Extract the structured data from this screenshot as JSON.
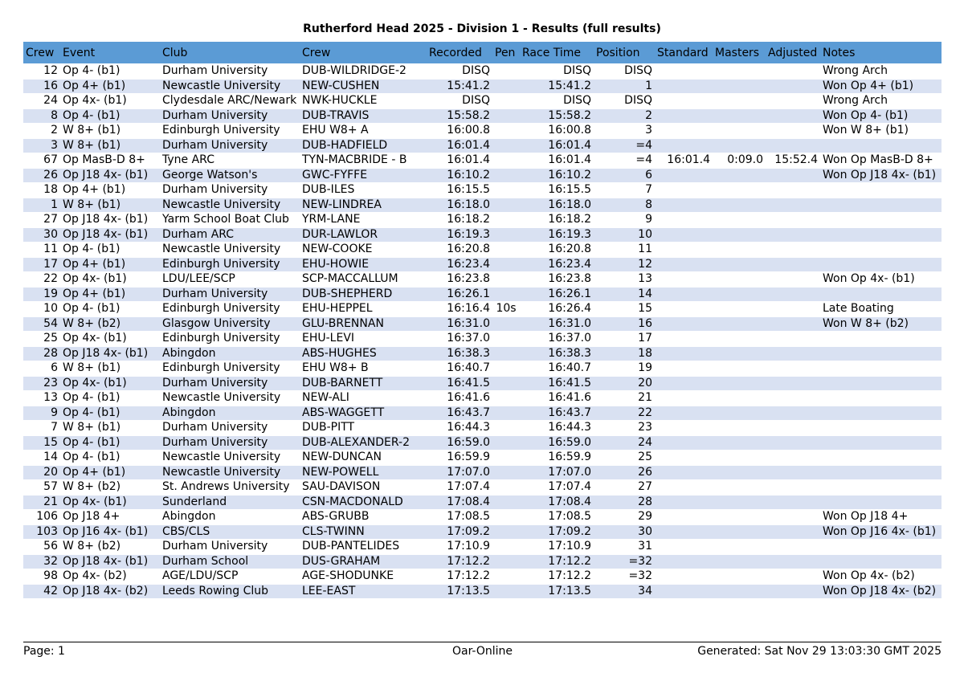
{
  "title": "Rutherford Head 2025 - Division 1 - Results (full results)",
  "colors": {
    "header_bg": "#5b9bd5",
    "stripe_bg": "#d9e1f2"
  },
  "columns": [
    "Crew",
    "Event",
    "Club",
    "Crew",
    "Recorded",
    "Pen",
    "Race Time",
    "Position",
    "Standard",
    "Masters",
    "Adjusted",
    "Notes"
  ],
  "rows": [
    [
      "12",
      "Op 4- (b1)",
      "Durham University",
      "DUB-WILDRIDGE-2",
      "DISQ",
      "",
      "DISQ",
      "DISQ",
      "",
      "",
      "",
      "Wrong Arch"
    ],
    [
      "16",
      "Op 4+ (b1)",
      "Newcastle University",
      "NEW-CUSHEN",
      "15:41.2",
      "",
      "15:41.2",
      "1",
      "",
      "",
      "",
      "Won Op 4+ (b1)"
    ],
    [
      "24",
      "Op 4x- (b1)",
      "Clydesdale ARC/Newark",
      "NWK-HUCKLE",
      "DISQ",
      "",
      "DISQ",
      "DISQ",
      "",
      "",
      "",
      "Wrong Arch"
    ],
    [
      "8",
      "Op 4- (b1)",
      "Durham University",
      "DUB-TRAVIS",
      "15:58.2",
      "",
      "15:58.2",
      "2",
      "",
      "",
      "",
      "Won Op 4- (b1)"
    ],
    [
      "2",
      "W 8+ (b1)",
      "Edinburgh University",
      "EHU W8+ A",
      "16:00.8",
      "",
      "16:00.8",
      "3",
      "",
      "",
      "",
      "Won W 8+ (b1)"
    ],
    [
      "3",
      "W 8+ (b1)",
      "Durham University",
      "DUB-HADFIELD",
      "16:01.4",
      "",
      "16:01.4",
      "=4",
      "",
      "",
      "",
      ""
    ],
    [
      "67",
      "Op MasB-D 8+",
      "Tyne ARC",
      "TYN-MACBRIDE - B",
      "16:01.4",
      "",
      "16:01.4",
      "=4",
      "16:01.4",
      "0:09.0",
      "15:52.4",
      "Won Op MasB-D 8+"
    ],
    [
      "26",
      "Op J18 4x- (b1)",
      "George Watson's",
      "GWC-FYFFE",
      "16:10.2",
      "",
      "16:10.2",
      "6",
      "",
      "",
      "",
      "Won Op J18 4x- (b1)"
    ],
    [
      "18",
      "Op 4+ (b1)",
      "Durham University",
      "DUB-ILES",
      "16:15.5",
      "",
      "16:15.5",
      "7",
      "",
      "",
      "",
      ""
    ],
    [
      "1",
      "W 8+ (b1)",
      "Newcastle University",
      "NEW-LINDREA",
      "16:18.0",
      "",
      "16:18.0",
      "8",
      "",
      "",
      "",
      ""
    ],
    [
      "27",
      "Op J18 4x- (b1)",
      "Yarm School Boat Club",
      "YRM-LANE",
      "16:18.2",
      "",
      "16:18.2",
      "9",
      "",
      "",
      "",
      ""
    ],
    [
      "30",
      "Op J18 4x- (b1)",
      "Durham ARC",
      "DUR-LAWLOR",
      "16:19.3",
      "",
      "16:19.3",
      "10",
      "",
      "",
      "",
      ""
    ],
    [
      "11",
      "Op 4- (b1)",
      "Newcastle University",
      "NEW-COOKE",
      "16:20.8",
      "",
      "16:20.8",
      "11",
      "",
      "",
      "",
      ""
    ],
    [
      "17",
      "Op 4+ (b1)",
      "Edinburgh University",
      "EHU-HOWIE",
      "16:23.4",
      "",
      "16:23.4",
      "12",
      "",
      "",
      "",
      ""
    ],
    [
      "22",
      "Op 4x- (b1)",
      "LDU/LEE/SCP",
      "SCP-MACCALLUM",
      "16:23.8",
      "",
      "16:23.8",
      "13",
      "",
      "",
      "",
      "Won Op 4x- (b1)"
    ],
    [
      "19",
      "Op 4+ (b1)",
      "Durham University",
      "DUB-SHEPHERD",
      "16:26.1",
      "",
      "16:26.1",
      "14",
      "",
      "",
      "",
      ""
    ],
    [
      "10",
      "Op 4- (b1)",
      "Edinburgh University",
      "EHU-HEPPEL",
      "16:16.4",
      "10s",
      "16:26.4",
      "15",
      "",
      "",
      "",
      "Late Boating"
    ],
    [
      "54",
      "W 8+ (b2)",
      "Glasgow University",
      "GLU-BRENNAN",
      "16:31.0",
      "",
      "16:31.0",
      "16",
      "",
      "",
      "",
      "Won W 8+ (b2)"
    ],
    [
      "25",
      "Op 4x- (b1)",
      "Edinburgh University",
      "EHU-LEVI",
      "16:37.0",
      "",
      "16:37.0",
      "17",
      "",
      "",
      "",
      ""
    ],
    [
      "28",
      "Op J18 4x- (b1)",
      "Abingdon",
      "ABS-HUGHES",
      "16:38.3",
      "",
      "16:38.3",
      "18",
      "",
      "",
      "",
      ""
    ],
    [
      "6",
      "W 8+ (b1)",
      "Edinburgh University",
      "EHU W8+ B",
      "16:40.7",
      "",
      "16:40.7",
      "19",
      "",
      "",
      "",
      ""
    ],
    [
      "23",
      "Op 4x- (b1)",
      "Durham University",
      "DUB-BARNETT",
      "16:41.5",
      "",
      "16:41.5",
      "20",
      "",
      "",
      "",
      ""
    ],
    [
      "13",
      "Op 4- (b1)",
      "Newcastle University",
      "NEW-ALI",
      "16:41.6",
      "",
      "16:41.6",
      "21",
      "",
      "",
      "",
      ""
    ],
    [
      "9",
      "Op 4- (b1)",
      "Abingdon",
      "ABS-WAGGETT",
      "16:43.7",
      "",
      "16:43.7",
      "22",
      "",
      "",
      "",
      ""
    ],
    [
      "7",
      "W 8+ (b1)",
      "Durham University",
      "DUB-PITT",
      "16:44.3",
      "",
      "16:44.3",
      "23",
      "",
      "",
      "",
      ""
    ],
    [
      "15",
      "Op 4- (b1)",
      "Durham University",
      "DUB-ALEXANDER-2",
      "16:59.0",
      "",
      "16:59.0",
      "24",
      "",
      "",
      "",
      ""
    ],
    [
      "14",
      "Op 4- (b1)",
      "Newcastle University",
      "NEW-DUNCAN",
      "16:59.9",
      "",
      "16:59.9",
      "25",
      "",
      "",
      "",
      ""
    ],
    [
      "20",
      "Op 4+ (b1)",
      "Newcastle University",
      "NEW-POWELL",
      "17:07.0",
      "",
      "17:07.0",
      "26",
      "",
      "",
      "",
      ""
    ],
    [
      "57",
      "W 8+ (b2)",
      "St. Andrews University",
      "SAU-DAVISON",
      "17:07.4",
      "",
      "17:07.4",
      "27",
      "",
      "",
      "",
      ""
    ],
    [
      "21",
      "Op 4x- (b1)",
      "Sunderland",
      "CSN-MACDONALD",
      "17:08.4",
      "",
      "17:08.4",
      "28",
      "",
      "",
      "",
      ""
    ],
    [
      "106",
      "Op J18 4+",
      "Abingdon",
      "ABS-GRUBB",
      "17:08.5",
      "",
      "17:08.5",
      "29",
      "",
      "",
      "",
      "Won Op J18 4+"
    ],
    [
      "103",
      "Op J16 4x- (b1)",
      "CBS/CLS",
      "CLS-TWINN",
      "17:09.2",
      "",
      "17:09.2",
      "30",
      "",
      "",
      "",
      "Won Op J16 4x- (b1)"
    ],
    [
      "56",
      "W 8+ (b2)",
      "Durham University",
      "DUB-PANTELIDES",
      "17:10.9",
      "",
      "17:10.9",
      "31",
      "",
      "",
      "",
      ""
    ],
    [
      "32",
      "Op J18 4x- (b1)",
      "Durham School",
      "DUS-GRAHAM",
      "17:12.2",
      "",
      "17:12.2",
      "=32",
      "",
      "",
      "",
      ""
    ],
    [
      "98",
      "Op 4x- (b2)",
      "AGE/LDU/SCP",
      "AGE-SHODUNKE",
      "17:12.2",
      "",
      "17:12.2",
      "=32",
      "",
      "",
      "",
      "Won Op 4x- (b2)"
    ],
    [
      "42",
      "Op J18 4x- (b2)",
      "Leeds Rowing Club",
      "LEE-EAST",
      "17:13.5",
      "",
      "17:13.5",
      "34",
      "",
      "",
      "",
      "Won Op J18 4x- (b2)"
    ]
  ],
  "footer": {
    "page": "Page: 1",
    "center": "Oar-Online",
    "generated": "Generated: Sat Nov 29 13:03:30 GMT 2025"
  }
}
